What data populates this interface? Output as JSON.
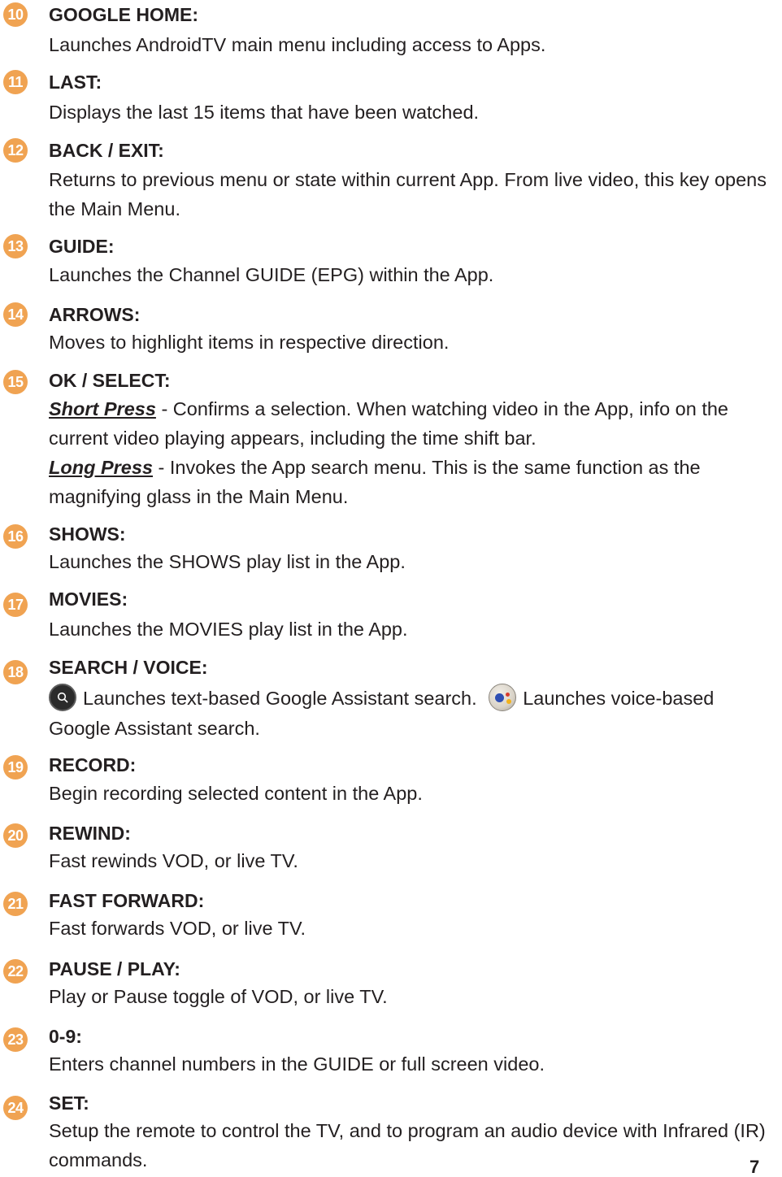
{
  "entries": [
    {
      "num": "10",
      "title": "GOOGLE HOME:",
      "desc": "Launches AndroidTV main menu including access to Apps."
    },
    {
      "num": "11",
      "title": "LAST:",
      "desc": "Displays the last 15 items that have been watched."
    },
    {
      "num": "12",
      "title": "BACK / EXIT:",
      "desc": "Returns to previous menu or state within current App. From live video, this key opens the Main Menu."
    },
    {
      "num": "13",
      "title": "GUIDE:",
      "desc": "Launches the Channel GUIDE (EPG) within the App."
    },
    {
      "num": "14",
      "title": "ARROWS:",
      "desc": "Moves to highlight items in respective direction."
    },
    {
      "num": "15",
      "title": "OK / SELECT:",
      "short_label": "Short Press",
      "short_desc": " - Confirms a selection. When watching video in the App, info on the current video playing appears, including the time shift bar.",
      "long_label": "Long Press",
      "long_desc": " - Invokes the App search menu. This is the same function as the magnifying glass in the Main Menu."
    },
    {
      "num": "16",
      "title": "SHOWS:",
      "desc": "Launches the SHOWS play list in the App."
    },
    {
      "num": "17",
      "title": "MOVIES:",
      "desc": "Launches the MOVIES play list in the App."
    },
    {
      "num": "18",
      "title": "SEARCH / VOICE:",
      "text_search": "Launches text-based Google Assistant search.",
      "voice_search": "Launches voice-based Google Assistant search."
    },
    {
      "num": "19",
      "title": "RECORD:",
      "desc": "Begin recording selected content in the App."
    },
    {
      "num": "20",
      "title": "REWIND:",
      "desc": "Fast rewinds VOD, or live TV."
    },
    {
      "num": "21",
      "title": "FAST FORWARD:",
      "desc": "Fast forwards VOD, or live TV."
    },
    {
      "num": "22",
      "title": "PAUSE / PLAY:",
      "desc": "Play or Pause toggle of VOD, or live TV."
    },
    {
      "num": "23",
      "title": "0-9:",
      "desc": "Enters channel numbers in the GUIDE or full screen video."
    },
    {
      "num": "24",
      "title": "SET:",
      "desc": "Setup the remote to control the TV, and to program an audio device with Infrared (IR) commands."
    }
  ],
  "page_number": "7",
  "colors": {
    "badge": "#f0a352",
    "text": "#231f20"
  },
  "icons": {
    "text_search": "magnifier-button-icon",
    "voice_search": "google-assistant-mic-icon"
  }
}
